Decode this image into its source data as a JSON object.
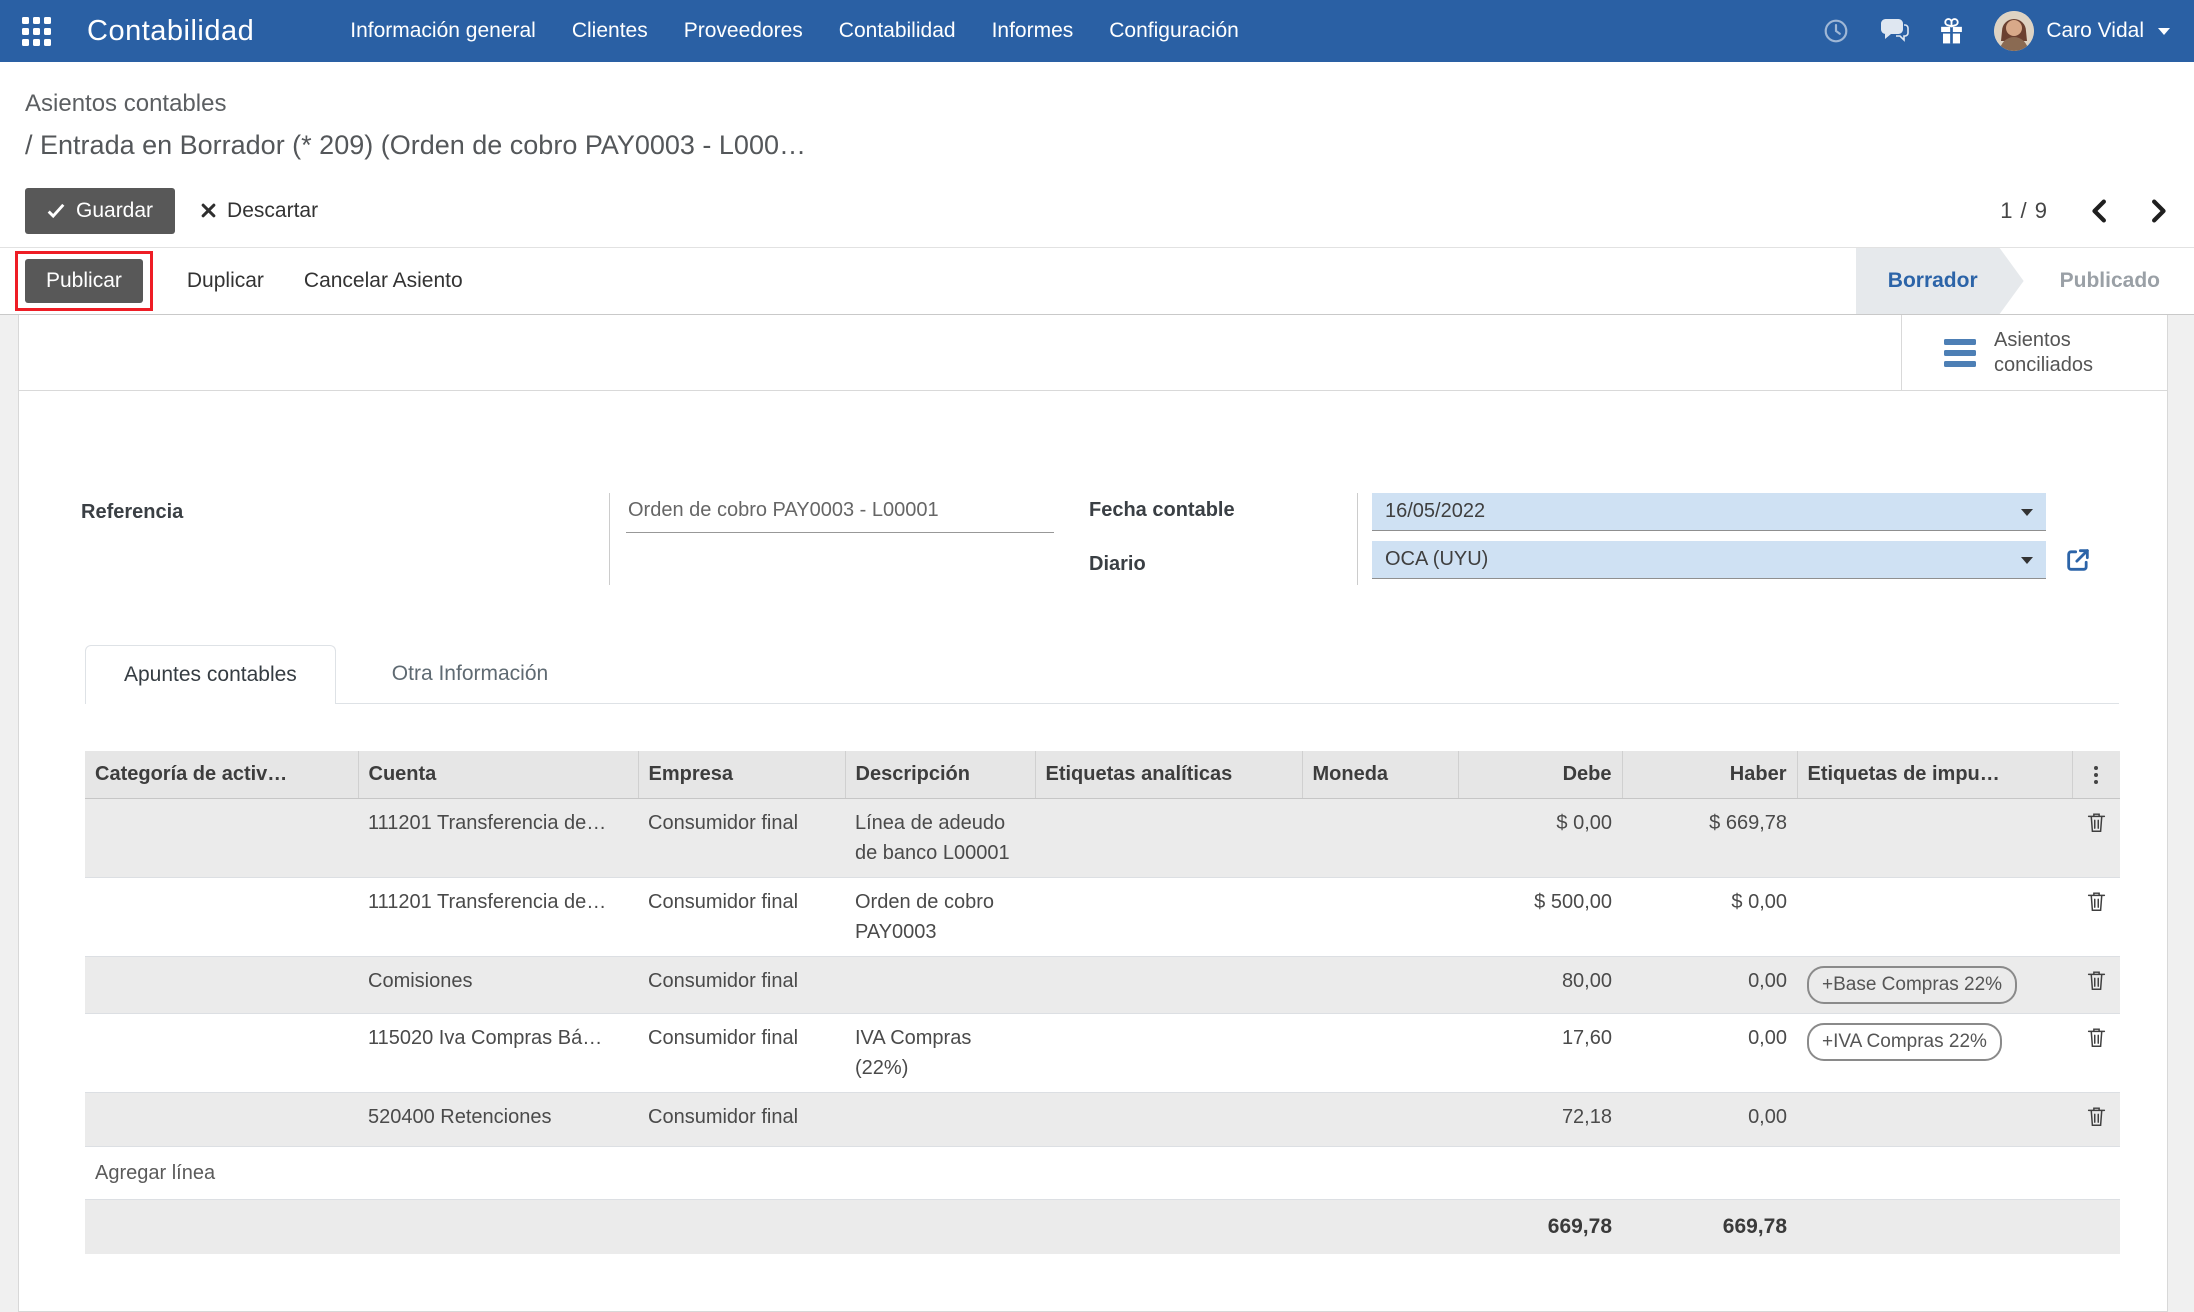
{
  "navbar": {
    "brand": "Contabilidad",
    "items": [
      "Información general",
      "Clientes",
      "Proveedores",
      "Contabilidad",
      "Informes",
      "Configuración"
    ],
    "user": "Caro Vidal",
    "icons": [
      "apps-grid-icon",
      "clock-icon",
      "chat-icon",
      "gift-icon",
      "avatar",
      "caret-down-icon"
    ]
  },
  "breadcrumb": {
    "parent": "Asientos contables",
    "separator": "/",
    "current": "Entrada en Borrador (* 209) (Orden de cobro PAY0003 - L000…"
  },
  "control_panel": {
    "save_label": "Guardar",
    "discard_label": "Descartar",
    "pager": "1 / 9"
  },
  "statusbar": {
    "publish_label": "Publicar",
    "duplicate_label": "Duplicar",
    "cancel_label": "Cancelar Asiento",
    "state_draft": "Borrador",
    "state_posted": "Publicado"
  },
  "smart_button": {
    "line1": "Asientos",
    "line2": "conciliados"
  },
  "form": {
    "reference": {
      "label": "Referencia",
      "value": "Orden de cobro PAY0003 - L00001"
    },
    "date": {
      "label": "Fecha contable",
      "value": "16/05/2022"
    },
    "journal": {
      "label": "Diario",
      "value": "OCA (UYU)"
    }
  },
  "tabs": {
    "active": "Apuntes contables",
    "inactive": "Otra Información"
  },
  "table": {
    "headers": [
      "Categoría de activ…",
      "Cuenta",
      "Empresa",
      "Descripción",
      "Etiquetas analíticas",
      "Moneda",
      "Debe",
      "Haber",
      "Etiquetas de impu…"
    ],
    "rows": [
      {
        "cuenta": "111201 Transferencia de…",
        "empresa": "Consumidor final",
        "descripcion": "Línea de adeudo de banco L00001",
        "debe": "$ 0,00",
        "haber": "$ 669,78",
        "tag": ""
      },
      {
        "cuenta": "111201 Transferencia de…",
        "empresa": "Consumidor final",
        "descripcion": "Orden de cobro PAY0003",
        "debe": "$ 500,00",
        "haber": "$ 0,00",
        "tag": ""
      },
      {
        "cuenta": "Comisiones",
        "empresa": "Consumidor final",
        "descripcion": "",
        "debe": "80,00",
        "haber": "0,00",
        "tag": "+Base Compras 22%"
      },
      {
        "cuenta": "115020 Iva Compras Bá…",
        "empresa": "Consumidor final",
        "descripcion": "IVA Compras (22%)",
        "debe": "17,60",
        "haber": "0,00",
        "tag": "+IVA Compras 22%"
      },
      {
        "cuenta": "520400 Retenciones",
        "empresa": "Consumidor final",
        "descripcion": "",
        "debe": "72,18",
        "haber": "0,00",
        "tag": ""
      }
    ],
    "add_line": "Agregar línea",
    "totals": {
      "debe": "669,78",
      "haber": "669,78"
    }
  },
  "colors": {
    "navbar_blue": "#2a60a4",
    "field_highlight_blue": "#cfe1f3",
    "annotation_red": "#ee1d25",
    "state_draft_blue": "#2c64a8",
    "button_gray": "#585858"
  }
}
